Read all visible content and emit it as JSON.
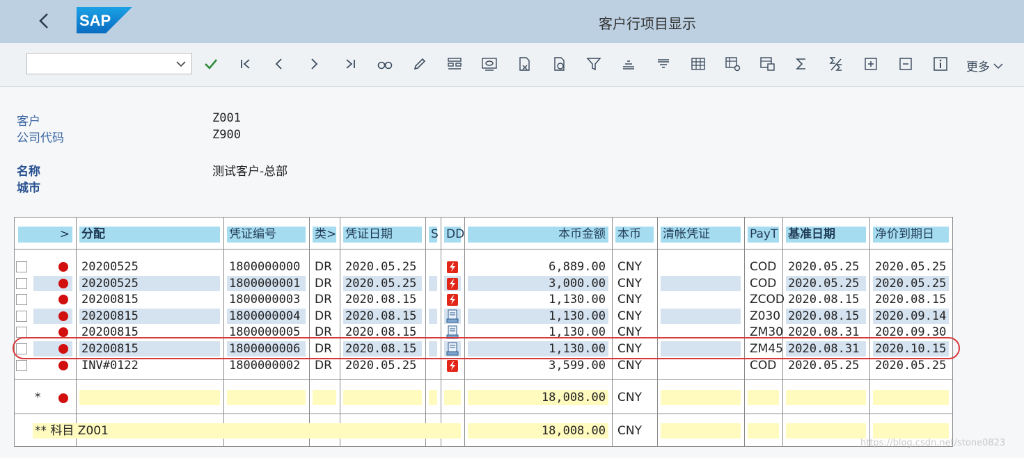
{
  "header": {
    "title": "客户行项目显示",
    "logo_text": "SAP"
  },
  "toolbar": {
    "combo_value": "",
    "more_label": "更多"
  },
  "info": {
    "customer_label": "客户",
    "customer_value": "Z001",
    "company_label": "公司代码",
    "company_value": "Z900",
    "name_label": "名称",
    "name_value": "测试客户-总部",
    "city_label": "城市"
  },
  "grid": {
    "headers": [
      ">",
      "分配",
      "凭证编号",
      "类>",
      "凭证日期",
      "S",
      "DD",
      "本币金额",
      "本币",
      "清帐凭证",
      "PayT",
      "基准日期",
      "净价到期日"
    ],
    "rows": [
      {
        "assign": "20200525",
        "docno": "1800000000",
        "type": "DR",
        "docdate": "2020.05.25",
        "dd": "flash",
        "amount": "6,889.00",
        "curr": "CNY",
        "clear": "",
        "payt": "COD",
        "basedate": "2020.05.25",
        "due": "2020.05.25"
      },
      {
        "assign": "20200525",
        "docno": "1800000001",
        "type": "DR",
        "docdate": "2020.05.25",
        "dd": "flash",
        "amount": "3,000.00",
        "curr": "CNY",
        "clear": "",
        "payt": "COD",
        "basedate": "2020.05.25",
        "due": "2020.05.25"
      },
      {
        "assign": "20200815",
        "docno": "1800000003",
        "type": "DR",
        "docdate": "2020.08.15",
        "dd": "flash",
        "amount": "1,130.00",
        "curr": "CNY",
        "clear": "",
        "payt": "ZCOD",
        "basedate": "2020.08.15",
        "due": "2020.08.15"
      },
      {
        "assign": "20200815",
        "docno": "1800000004",
        "type": "DR",
        "docdate": "2020.08.15",
        "dd": "doc",
        "amount": "1,130.00",
        "curr": "CNY",
        "clear": "",
        "payt": "Z030",
        "basedate": "2020.08.15",
        "due": "2020.09.14"
      },
      {
        "assign": "20200815",
        "docno": "1800000005",
        "type": "DR",
        "docdate": "2020.08.15",
        "dd": "doc",
        "amount": "1,130.00",
        "curr": "CNY",
        "clear": "",
        "payt": "ZM30",
        "basedate": "2020.08.31",
        "due": "2020.09.30"
      },
      {
        "assign": "20200815",
        "docno": "1800000006",
        "type": "DR",
        "docdate": "2020.08.15",
        "dd": "doc",
        "amount": "1,130.00",
        "curr": "CNY",
        "clear": "",
        "payt": "ZM45",
        "basedate": "2020.08.31",
        "due": "2020.10.15"
      },
      {
        "assign": "INV#0122",
        "docno": "1800000002",
        "type": "DR",
        "docdate": "2020.05.25",
        "dd": "flash",
        "amount": "3,599.00",
        "curr": "CNY",
        "clear": "",
        "payt": "COD",
        "basedate": "2020.05.25",
        "due": "2020.05.25"
      }
    ],
    "subtotal": {
      "marker": "*",
      "amount": "18,008.00",
      "curr": "CNY"
    },
    "total": {
      "marker": "**",
      "label": "科目 Z001",
      "amount": "18,008.00",
      "curr": "CNY"
    }
  },
  "watermark": "https://blog.csdn.net/stone0823",
  "colors": {
    "header_bg": "#bcd0e2",
    "column_header": "#a6dcf0",
    "row_shade": "#d5e2f0",
    "total_bg": "#fffbbf",
    "status_red": "#d10f0f",
    "highlight_circle": "#d9383a"
  }
}
